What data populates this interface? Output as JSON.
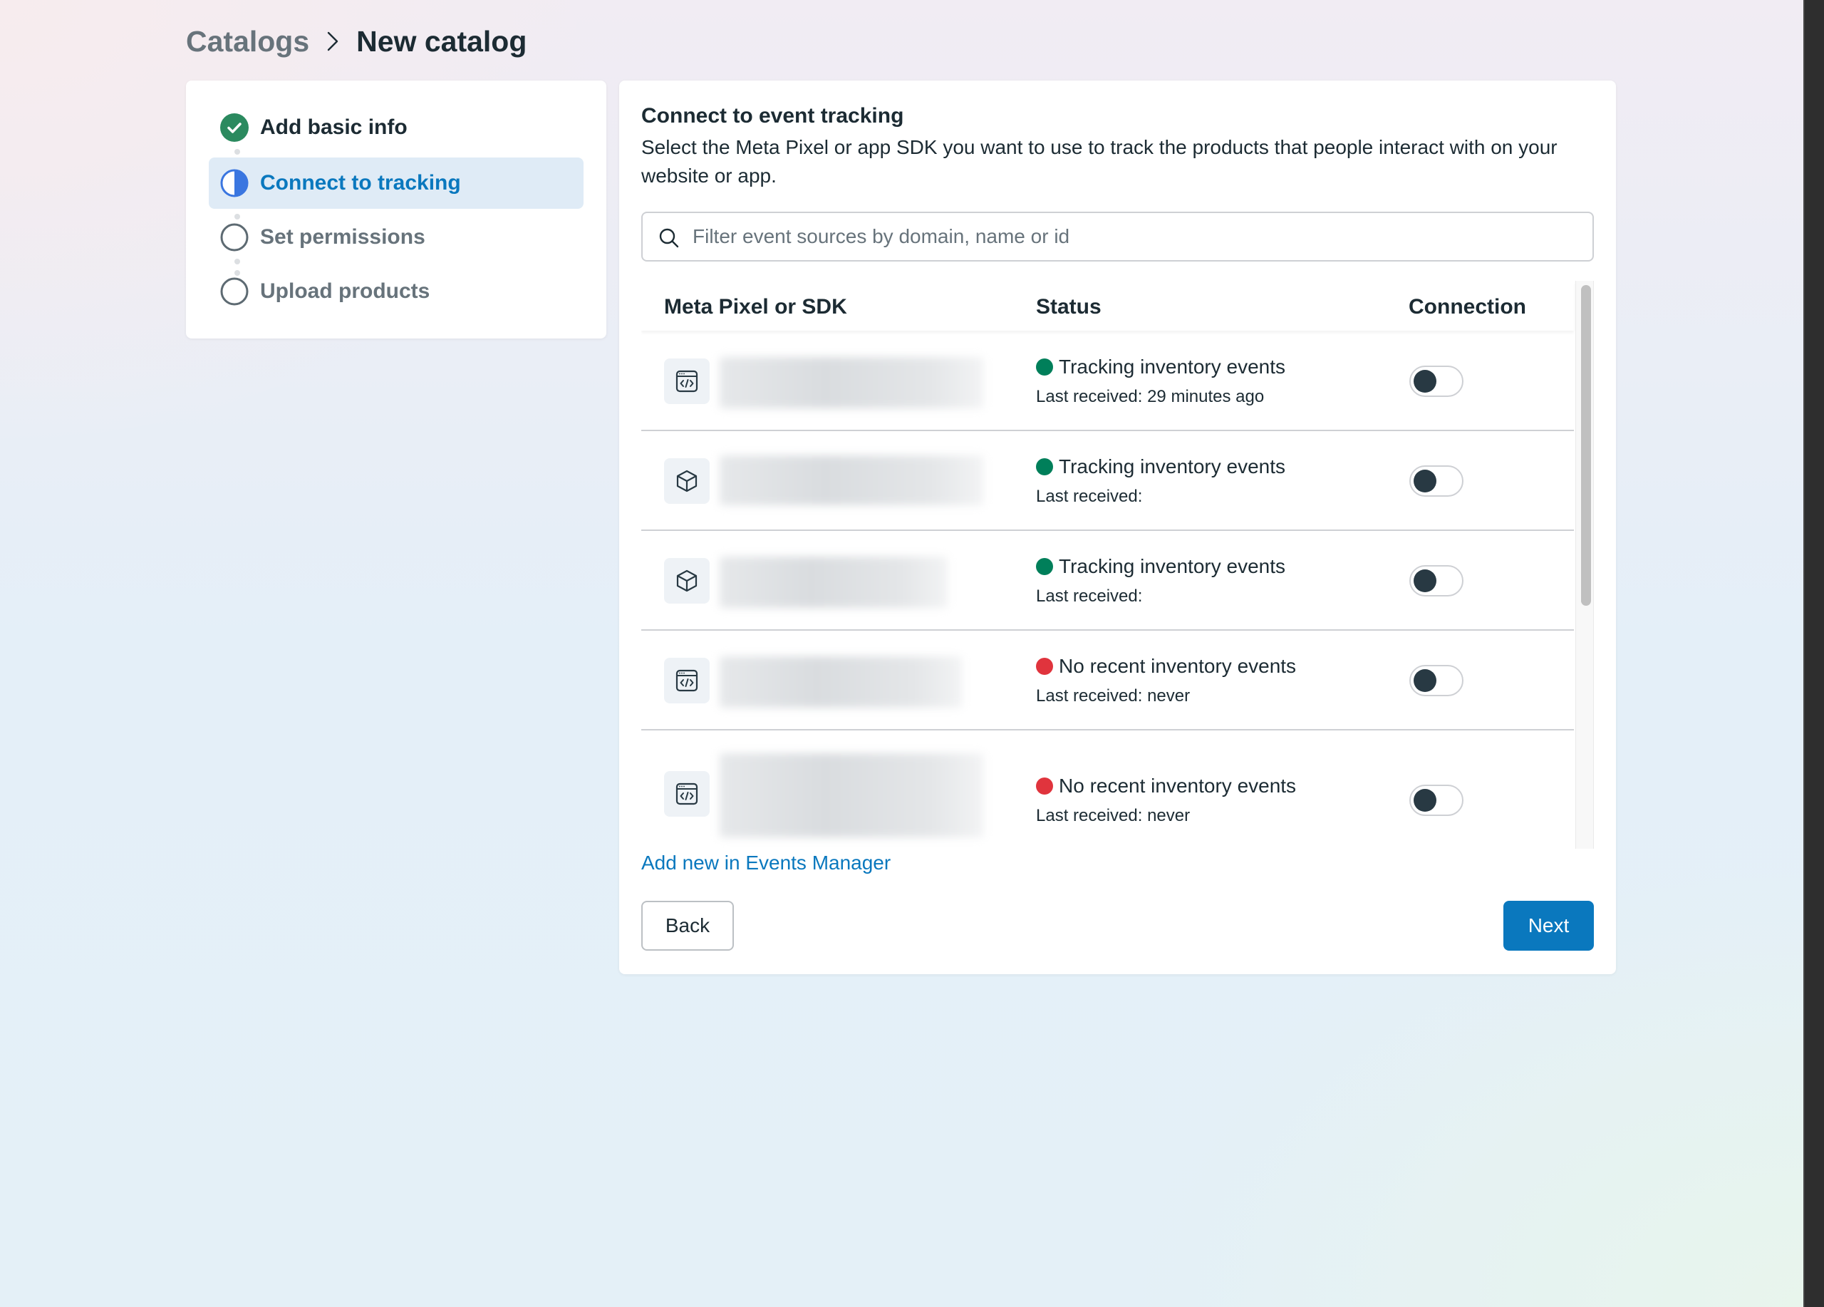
{
  "breadcrumb": {
    "parent": "Catalogs",
    "separator_icon": "chevron-right-icon",
    "current": "New catalog"
  },
  "steps": [
    {
      "label": "Add basic info",
      "state": "complete",
      "icon": "check-circle-icon"
    },
    {
      "label": "Connect to tracking",
      "state": "in-progress",
      "icon": "half-circle-icon"
    },
    {
      "label": "Set permissions",
      "state": "not-started",
      "icon": "empty-circle-icon"
    },
    {
      "label": "Upload products",
      "state": "not-started",
      "icon": "empty-circle-icon"
    }
  ],
  "main": {
    "title": "Connect to event tracking",
    "description": "Select the Meta Pixel or app SDK you want to use to track the products that people interact with on your website or app.",
    "search": {
      "placeholder": "Filter event sources by domain, name or id",
      "value": ""
    },
    "table": {
      "columns": [
        "Meta Pixel or SDK",
        "Status",
        "Connection"
      ],
      "rows": [
        {
          "source_type": "pixel",
          "icon": "code-window-icon",
          "name": "[redacted]",
          "status": "Tracking inventory events",
          "status_color": "#007f5a",
          "last_received": "Last received: 29 minutes ago",
          "connected": false
        },
        {
          "source_type": "app-sdk",
          "icon": "cube-icon",
          "name": "[redacted]",
          "status": "Tracking inventory events",
          "status_color": "#007f5a",
          "last_received": "Last received:",
          "connected": false
        },
        {
          "source_type": "app-sdk",
          "icon": "cube-icon",
          "name": "[redacted]",
          "status": "Tracking inventory events",
          "status_color": "#007f5a",
          "last_received": "Last received:",
          "connected": false
        },
        {
          "source_type": "pixel",
          "icon": "code-window-icon",
          "name": "[redacted]",
          "status": "No recent inventory events",
          "status_color": "#e0343d",
          "last_received": "Last received: never",
          "connected": false
        },
        {
          "source_type": "pixel",
          "icon": "code-window-icon",
          "name": "[redacted]",
          "status": "No recent inventory events",
          "status_color": "#e0343d",
          "last_received": "Last received: never",
          "connected": false
        }
      ]
    },
    "add_link": "Add new in Events Manager",
    "back_label": "Back",
    "next_label": "Next"
  },
  "colors": {
    "accent": "#0a78be",
    "success": "#007f5a",
    "error": "#e0343d",
    "step_complete": "#2b8a5f",
    "step_active": "#3a76e0",
    "text_primary": "#1c2b33",
    "text_secondary": "#67737b"
  }
}
